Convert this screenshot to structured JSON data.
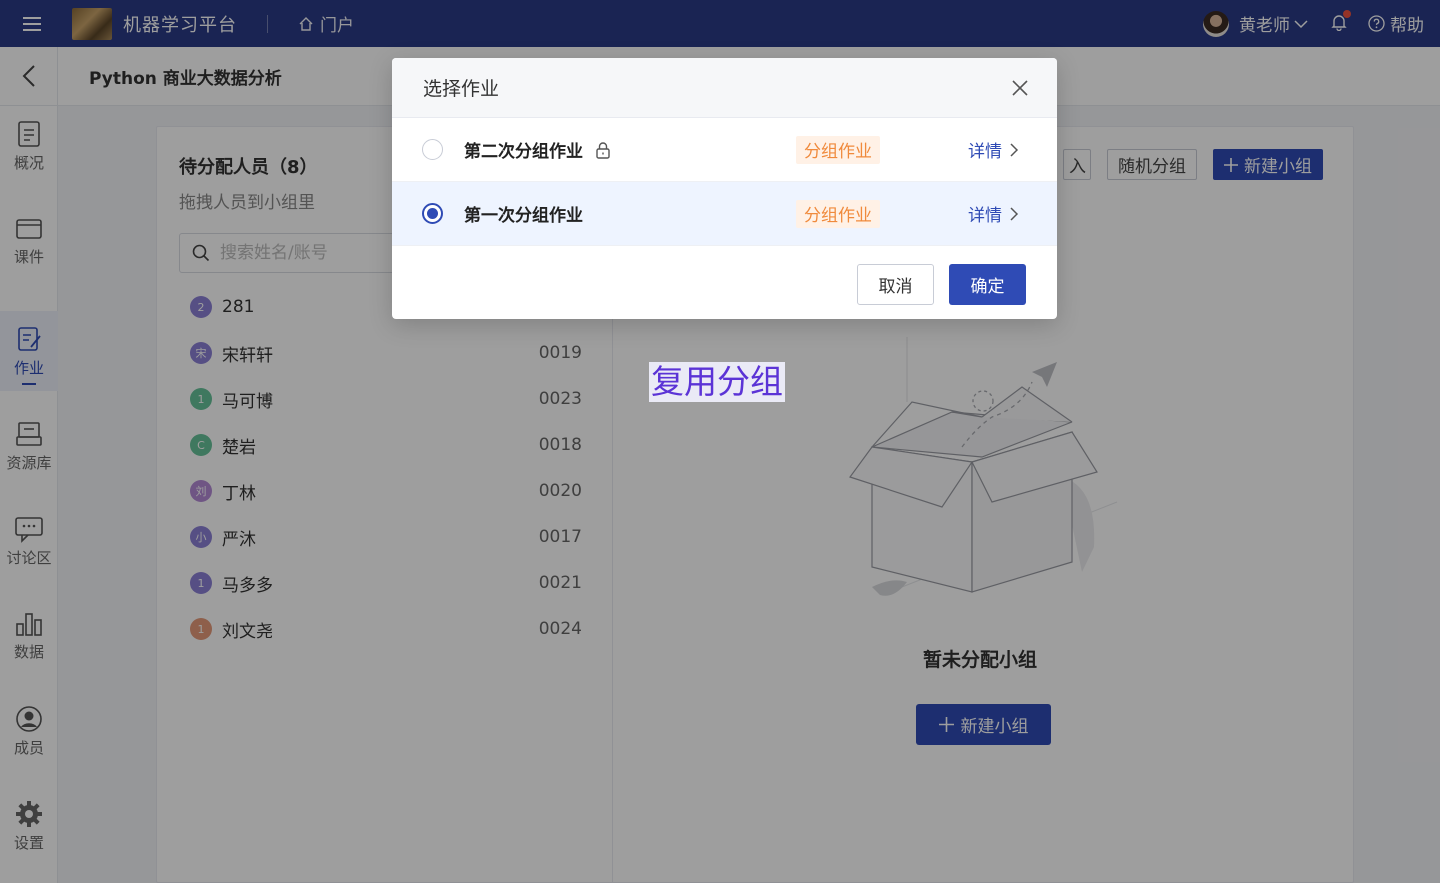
{
  "topbar": {
    "app_title": "机器学习平台",
    "portal_label": "门户",
    "user_name": "黄老师",
    "help_label": "帮助"
  },
  "subheader": {
    "course_title": "Python 商业大数据分析"
  },
  "sidebar": {
    "items": [
      {
        "label": "概况",
        "icon": "overview-icon"
      },
      {
        "label": "课件",
        "icon": "courseware-icon"
      },
      {
        "label": "作业",
        "icon": "homework-icon",
        "active": true
      },
      {
        "label": "资源库",
        "icon": "library-icon"
      },
      {
        "label": "讨论区",
        "icon": "discussion-icon"
      },
      {
        "label": "数据",
        "icon": "data-icon"
      },
      {
        "label": "成员",
        "icon": "member-icon"
      },
      {
        "label": "设置",
        "icon": "settings-icon"
      }
    ]
  },
  "unassigned": {
    "title": "待分配人员（8）",
    "subtitle": "拖拽人员到小组里",
    "search_placeholder": "搜索姓名/账号",
    "people": [
      {
        "avatar": "2",
        "name": "281",
        "id": "",
        "color": "#8b80d6"
      },
      {
        "avatar": "宋",
        "name": "宋轩轩",
        "id": "0019",
        "color": "#8b80d6"
      },
      {
        "avatar": "1",
        "name": "马可博",
        "id": "0023",
        "color": "#66c29a"
      },
      {
        "avatar": "C",
        "name": "楚岩",
        "id": "0018",
        "color": "#66c29a"
      },
      {
        "avatar": "刘",
        "name": "丁林",
        "id": "0020",
        "color": "#b38ad6"
      },
      {
        "avatar": "小",
        "name": "严沐",
        "id": "0017",
        "color": "#8b80d6"
      },
      {
        "avatar": "1",
        "name": "马多多",
        "id": "0021",
        "color": "#8b80d6"
      },
      {
        "avatar": "1",
        "name": "刘文尧",
        "id": "0024",
        "color": "#e59a7a"
      }
    ]
  },
  "group_actions": {
    "partial_label": "入",
    "random_label": "随机分组",
    "new_group_label": "新建小组"
  },
  "empty_state": {
    "title": "暂未分配小组",
    "button_label": "新建小组"
  },
  "reuse_label": "复用分组",
  "modal": {
    "title": "选择作业",
    "rows": [
      {
        "name": "第二次分组作业",
        "tag": "分组作业",
        "detail": "详情",
        "selected": false,
        "locked": true
      },
      {
        "name": "第一次分组作业",
        "tag": "分组作业",
        "detail": "详情",
        "selected": true,
        "locked": false
      }
    ],
    "cancel_label": "取消",
    "ok_label": "确定"
  },
  "colors": {
    "primary": "#2f4bb5",
    "topbar": "#2b3a86",
    "tag_text": "#f08a3c",
    "tag_bg": "#fff1e6"
  }
}
